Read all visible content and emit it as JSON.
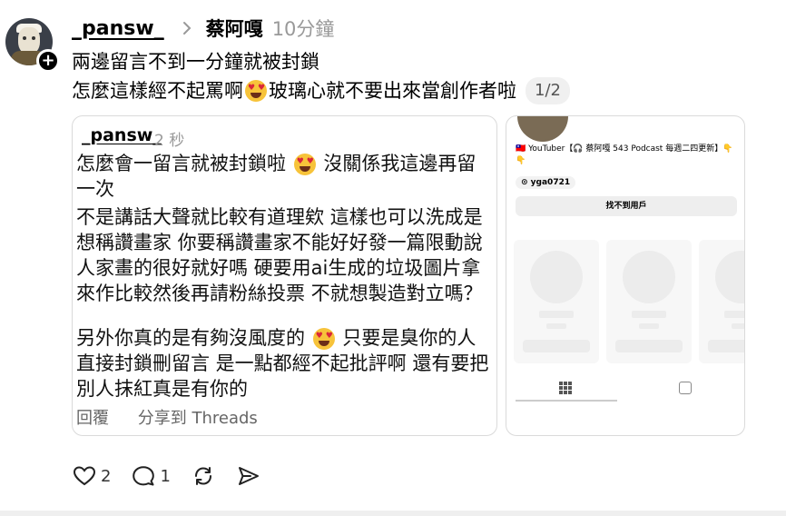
{
  "post": {
    "username": "_pansw_",
    "reply_to": "蔡阿嘎",
    "time": "10分鐘",
    "line1": "兩邊留言不到一分鐘就被封鎖",
    "line2_a": "怎麼這樣經不起罵啊",
    "line2_b": "玻璃心就不要出來當創作者啦",
    "page_indicator": "1/2"
  },
  "card_left": {
    "username": "_pansw_",
    "time": "2 秒",
    "text1a": "怎麼會一留言就被封鎖啦",
    "text1b": "沒關係我這邊再留一次",
    "text2": "不是講話大聲就比較有道理欸 這樣也可以洗成是想稱讚畫家 你要稱讚畫家不能好好發一篇限動說人家畫的很好就好嗎 硬要用ai生成的垃圾圖片拿來作比較然後再請粉絲投票 不就想製造對立嗎？",
    "text3a": "另外你真的是有夠沒風度的",
    "text3b": "只要是臭你的人直接封鎖刪留言 是一點都經不起批評啊 還有要把別人抹紅真是有你的",
    "reply_label": "回覆",
    "share_label": "分享到 Threads"
  },
  "card_right": {
    "bio": "🇹🇼 YouTuber【🎧 蔡阿嘎 543 Podcast 每週二四更新】👇👇",
    "link": "⊙ yga0721",
    "button": "找不到用戶"
  },
  "actions": {
    "likes": "2",
    "comments": "1"
  },
  "icons": [
    "plus-icon",
    "chevron-right-icon",
    "heart-icon",
    "comment-icon",
    "repost-icon",
    "share-icon",
    "grid-icon",
    "tagged-icon"
  ]
}
